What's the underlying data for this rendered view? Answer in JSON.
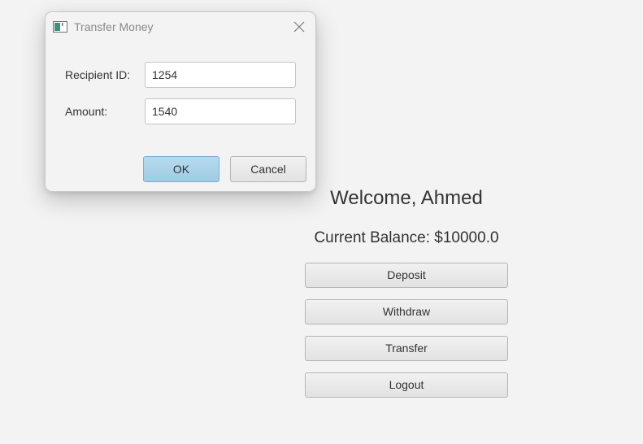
{
  "main": {
    "welcome_text": "Welcome, Ahmed",
    "balance_text": "Current Balance: $10000.0",
    "buttons": {
      "deposit": "Deposit",
      "withdraw": "Withdraw",
      "transfer": "Transfer",
      "logout": "Logout"
    }
  },
  "dialog": {
    "title": "Transfer Money",
    "recipient_label": "Recipient ID:",
    "recipient_value": "1254",
    "amount_label": "Amount:",
    "amount_value": "1540",
    "ok_label": "OK",
    "cancel_label": "Cancel"
  },
  "colors": {
    "background": "#f3f3f3",
    "ok_button": "#a9d1e8",
    "text": "#333333"
  },
  "icons": {
    "app_icon": "window-app-icon",
    "close": "close-icon"
  }
}
